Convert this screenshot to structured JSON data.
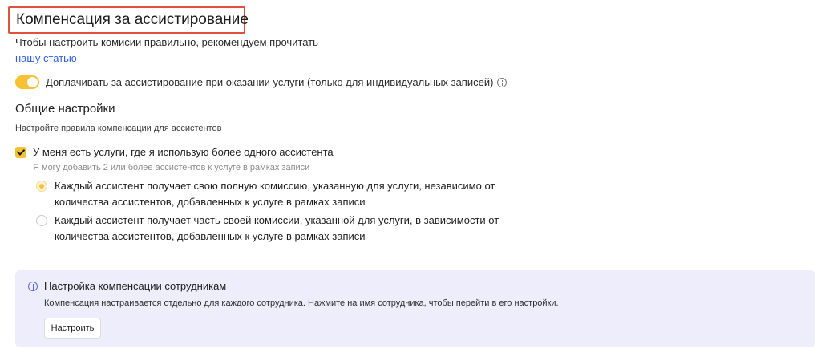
{
  "header": {
    "title": "Компенсация за ассистирование",
    "intro_text": "Чтобы настроить комисии правильно, рекомендуем прочитать ",
    "intro_link": "нашу статью"
  },
  "toggle": {
    "label": "Доплачивать за ассистирование при оказании услуги (только для индивидуальных записей)",
    "on": true
  },
  "general": {
    "title": "Общие настройки",
    "subtitle": "Настройте правила компенсации для ассистентов"
  },
  "multi_assistant": {
    "label": "У меня есть услуги, где я использую более одного ассистента",
    "hint": "Я могу добавить 2 или более ассистентов к услуге в рамках записи",
    "checked": true,
    "options": [
      {
        "label": "Каждый ассистент получает свою полную комиссию, указанную для услуги, независимо от количества ассистентов, добавленных к услуге в рамках записи",
        "selected": true
      },
      {
        "label": "Каждый ассистент получает часть своей комиссии, указанной для услуги, в зависимости от количества ассистентов, добавленных к услуге в рамках записи",
        "selected": false
      }
    ]
  },
  "staff_panel": {
    "title": "Настройка компенсации сотрудникам",
    "text": "Компенсация настраивается отдельно для каждого сотрудника. Нажмите на имя сотрудника, чтобы перейти в его настройки.",
    "button": "Настроить"
  },
  "colors": {
    "accent": "#f6c233",
    "highlight_border": "#e0503c",
    "link": "#2f5fe0",
    "panel_bg": "#eeedfb"
  }
}
